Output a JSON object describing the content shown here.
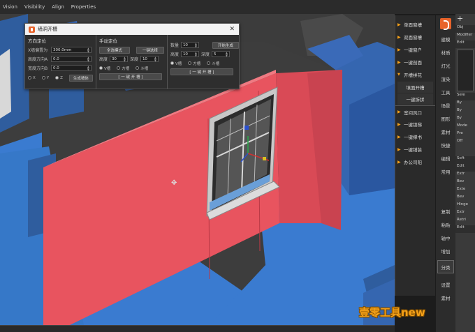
{
  "menubar": {
    "items": [
      "Vision",
      "Visibility",
      "Align",
      "Properties"
    ]
  },
  "dialog": {
    "title": "墙洞开槽",
    "close_icon": "close-icon",
    "col1": {
      "title": "方向定位",
      "fields": [
        {
          "label": "X墙偏置为",
          "value": "300.0mm"
        },
        {
          "label": "高度方向A",
          "value": "0.0"
        },
        {
          "label": "宽度方向B",
          "value": "0.0"
        }
      ],
      "axis_options": [
        "X",
        "Y",
        "Z"
      ],
      "axis_selected": "Z",
      "button": "生成墙体"
    },
    "col2": {
      "title": "手动定位",
      "buttons": [
        "全选模式",
        "一键选择"
      ],
      "fields": [
        {
          "label": "高度",
          "value": "30"
        },
        {
          "label": "深度",
          "value": "10"
        }
      ],
      "radio_options": [
        "V槽",
        "方槽",
        "斗槽"
      ],
      "radio_selected": "V槽",
      "action": "[ 一 键 开 槽 ]"
    },
    "col3": {
      "fields": [
        {
          "label": "数量",
          "value": "10"
        },
        {
          "label": "高度",
          "value": "10"
        },
        {
          "label": "深度",
          "value": "5"
        }
      ],
      "button": "开始生成",
      "radio_options": [
        "V槽",
        "方槽",
        "斗槽"
      ],
      "radio_selected": "V槽",
      "action": "[ 一 键 开 槽 ]"
    }
  },
  "command_panel": {
    "items": [
      {
        "label": "单面窗槽",
        "type": "item"
      },
      {
        "label": "双面窗槽",
        "type": "item"
      },
      {
        "label": "一键窗户",
        "type": "item"
      },
      {
        "label": "一键剖面",
        "type": "item"
      },
      {
        "label": "开槽拼花",
        "type": "expanded"
      },
      {
        "label": "填面开槽",
        "type": "sub"
      },
      {
        "label": "一键拆拼",
        "type": "sub"
      },
      {
        "label": "室间风口",
        "type": "item"
      },
      {
        "label": "一键锁梯",
        "type": "item"
      },
      {
        "label": "一键撑书",
        "type": "item"
      },
      {
        "label": "一键铺装",
        "type": "item"
      },
      {
        "label": "办公司阳",
        "type": "item"
      }
    ]
  },
  "vertical_tabs": {
    "items": [
      "建模",
      "材质",
      "灯光",
      "渲染",
      "工具",
      "场景",
      "图形",
      "素材",
      "快捷",
      "编辑",
      "常用",
      "",
      "",
      "",
      "",
      "复制",
      "粘贴",
      "轴中",
      "增加",
      "",
      "分类",
      "",
      "设置",
      "素材"
    ],
    "selected": "分类"
  },
  "right_strip": {
    "plus": "+",
    "items": [
      "Obj",
      "Modifier",
      "Edit",
      "",
      "",
      "",
      "",
      "",
      "Sele",
      "By",
      "By",
      "By",
      "",
      "Mode",
      "Pre",
      "Off",
      "",
      "Soft",
      "Edit",
      "Extr",
      "Bev",
      "Exte",
      "Bev",
      "Hinge",
      "Extr",
      "Retri",
      "Edit"
    ]
  },
  "watermark": "壹零工具new",
  "colors": {
    "wall": "#e8545f",
    "wall_dark": "#c94350",
    "floor": "#3a7bd0",
    "floor_light": "#4a8ee0",
    "block": "#3566b0",
    "accent": "#f4a018"
  }
}
